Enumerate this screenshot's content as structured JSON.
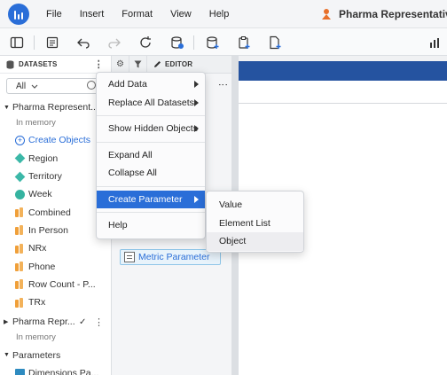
{
  "menubar": {
    "items": [
      "File",
      "Insert",
      "Format",
      "View",
      "Help"
    ],
    "doc_title": "Pharma Representatives I"
  },
  "toolbar": {
    "icons": [
      "panel-toggle-icon",
      "table-of-contents-icon",
      "undo-icon",
      "redo-icon",
      "refresh-icon",
      "data-source-icon",
      "add-dataset-icon",
      "paste-icon",
      "new-page-icon",
      "chart-icon"
    ]
  },
  "datasets": {
    "header": "DATASETS",
    "filter_value": "All",
    "dataset1": {
      "name": "Pharma Represent...",
      "mode": "In memory",
      "create_objects": "Create Objects",
      "items": [
        {
          "label": "Region",
          "icon": "attribute-icon"
        },
        {
          "label": "Territory",
          "icon": "attribute-icon"
        },
        {
          "label": "Week",
          "icon": "time-attribute-icon"
        },
        {
          "label": "Combined",
          "icon": "metric-icon"
        },
        {
          "label": "In Person",
          "icon": "metric-icon"
        },
        {
          "label": "NRx",
          "icon": "metric-icon"
        },
        {
          "label": "Phone",
          "icon": "metric-icon"
        },
        {
          "label": "Row Count - P...",
          "icon": "metric-icon"
        },
        {
          "label": "TRx",
          "icon": "metric-icon"
        }
      ]
    },
    "dataset2": {
      "name": "Pharma Repr...",
      "check": "✓",
      "mode": "In memory"
    },
    "parameters": {
      "label": "Parameters",
      "items": [
        {
          "label": "Dimensions Pa..."
        }
      ]
    }
  },
  "editor": {
    "tab_label": "EDITOR",
    "metric_parameter": "Metric Parameter"
  },
  "context_menu": {
    "items": [
      {
        "label": "Add Data",
        "submenu": true
      },
      {
        "label": "Replace All Datasets",
        "submenu": true
      },
      {
        "label": "Show Hidden Objects",
        "submenu": true
      },
      {
        "label": "Expand All",
        "submenu": false
      },
      {
        "label": "Collapse All",
        "submenu": false
      },
      {
        "label": "Create Parameter",
        "submenu": true,
        "active": true
      },
      {
        "label": "Help",
        "submenu": false
      }
    ],
    "submenu": {
      "items": [
        "Value",
        "Element List",
        "Object"
      ],
      "hovered": "Object"
    }
  },
  "colors": {
    "accent": "#2a6ed8",
    "canvas_header": "#2553a0",
    "attribute": "#3cb8a8",
    "metric": "#f0a03a"
  }
}
